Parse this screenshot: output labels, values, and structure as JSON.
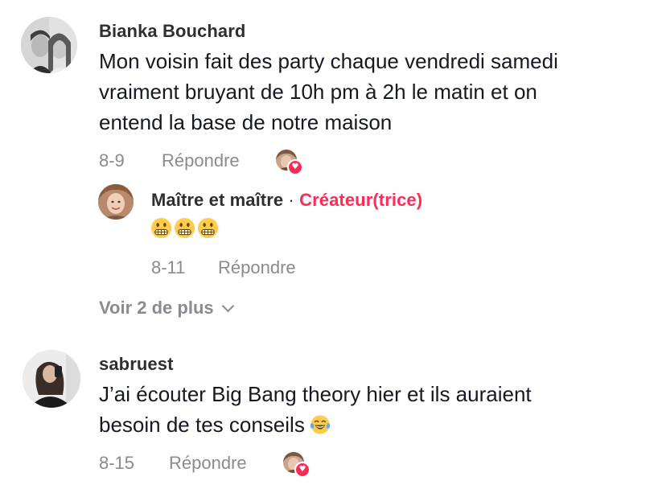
{
  "comments": [
    {
      "username": "Bianka Bouchard",
      "text_lines": [
        "Mon voisin fait des party chaque vendredi samedi",
        "vraiment bruyant de 10h pm à 2h le matin et on",
        "entend la base de notre maison"
      ],
      "date": "8-9",
      "reply_label": "Répondre",
      "creator_liked": true,
      "replies": [
        {
          "username": "Maître et maître",
          "separator": " · ",
          "badge": "Créateur(trice)",
          "emoji": [
            "grimacing-face",
            "grimacing-face",
            "grimacing-face"
          ],
          "date": "8-11",
          "reply_label": "Répondre"
        }
      ],
      "view_more_label": "Voir 2 de plus"
    },
    {
      "username": "sabruest",
      "text_lines": [
        "J’ai écouter Big Bang theory hier et ils auraient",
        "besoin de tes conseils"
      ],
      "trailing_emoji": "face-with-tears-of-joy",
      "date": "8-15",
      "reply_label": "Répondre",
      "creator_liked": true
    }
  ],
  "colors": {
    "accent": "#fe2c55",
    "text": "#161823",
    "muted": "#8a8b91"
  }
}
